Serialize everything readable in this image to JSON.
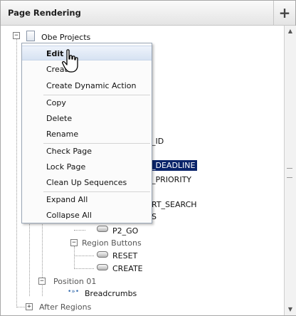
{
  "panel": {
    "title": "Page Rendering",
    "add_label": "+"
  },
  "tree": {
    "root": "Obe Projects",
    "item_id_suffix": "_ID",
    "item_deadline_suffix": "_DEADLINE",
    "item_priority_suffix": "_PRIORITY",
    "item_search_suffix": "RT_SEARCH",
    "item_s_suffix": "S",
    "p2_go": "P2_GO",
    "region_buttons": "Region Buttons",
    "reset": "RESET",
    "create": "CREATE",
    "position01": "Position 01",
    "breadcrumbs": "Breadcrumbs",
    "after_regions": "After Regions"
  },
  "context_menu": {
    "items": [
      "Edit",
      "Create",
      "Create Dynamic Action",
      "Copy",
      "Delete",
      "Rename",
      "Check Page",
      "Lock Page",
      "Clean Up Sequences",
      "Expand All",
      "Collapse All"
    ]
  },
  "colors": {
    "selection": "#0a246a",
    "header_bg": "#e4e4e4",
    "menu_active": "#d6e2f2"
  }
}
